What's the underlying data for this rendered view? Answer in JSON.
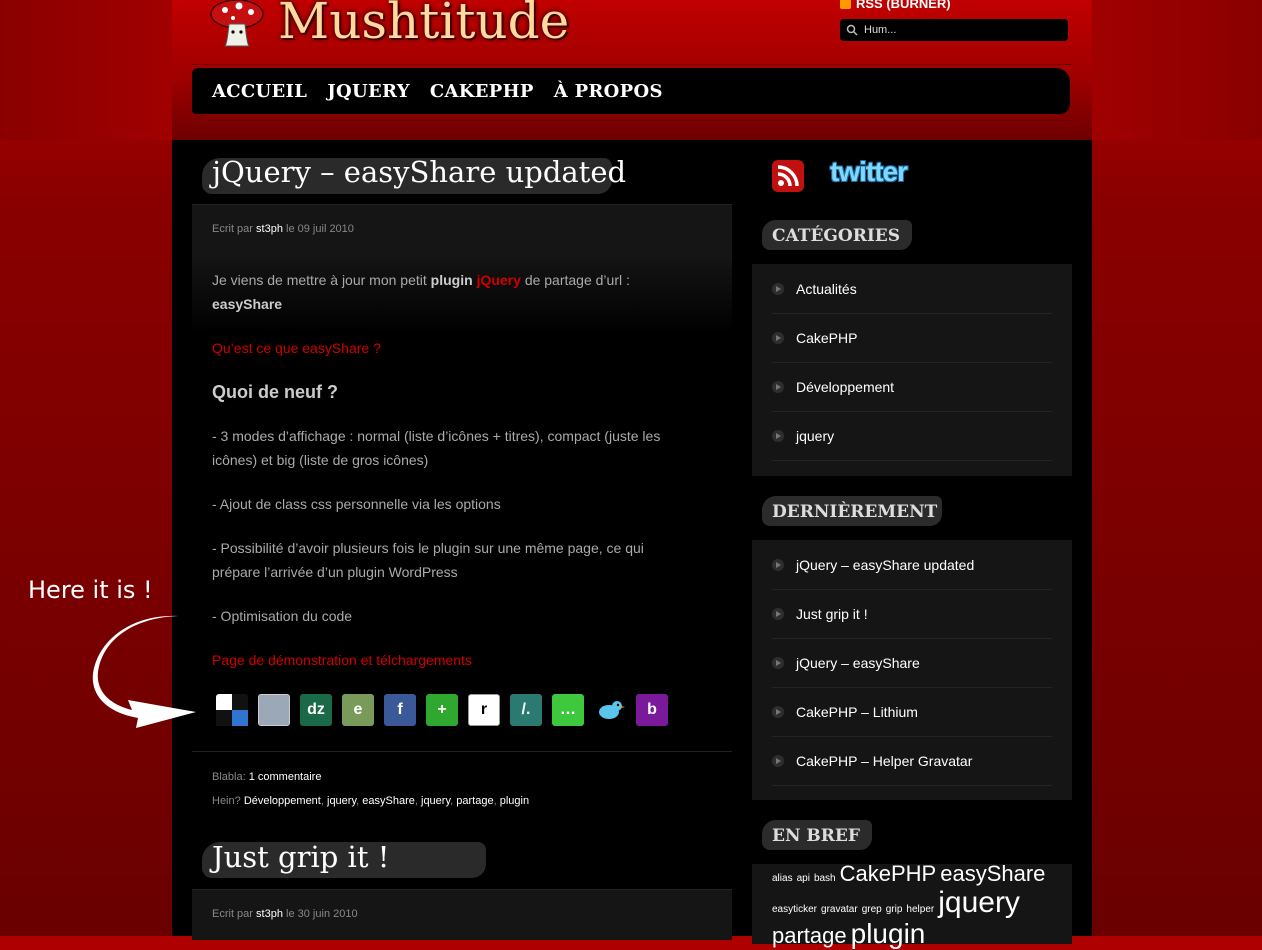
{
  "site": {
    "title": "Mushtitude"
  },
  "header": {
    "rss_label": "RSS (BURNER)",
    "search_value": "Hum..."
  },
  "nav": [
    "ACCUEIL",
    "JQUERY",
    "CAKEPHP",
    "À PROPOS"
  ],
  "posts": [
    {
      "title": "jQuery – easyShare updated",
      "meta_prefix": "Ecrit par",
      "author": "st3ph",
      "meta_date_prefix": "le",
      "date": "09 juil 2010",
      "intro_1": "Je viens de mettre à jour mon petit",
      "intro_plugin": "plugin",
      "intro_jquery": "jQuery",
      "intro_2": "de partage d’url :",
      "intro_easyshare": "easyShare",
      "link_what": "Qu’est ce que easyShare ?",
      "heading_new": "Quoi de neuf ?",
      "p1": "- 3 modes d’affichage : normal (liste d’icônes + titres), compact (juste les icônes) et big (liste de gros icônes)",
      "p2": "- Ajout de class css personnelle via les options",
      "p3": "- Possibilité d’avoir plusieurs fois le plugin sur une même page, ce qui prépare l’arrivée d’un plugin WordPress",
      "p4": "- Optimisation du code",
      "link_demo": "Page de démonstration et télchargements",
      "blabla_label": "Blabla:",
      "comments": "1 commentaire",
      "hein_label": "Hein?",
      "tags": [
        "Développement",
        "jquery",
        "easyShare",
        "jquery",
        "partage",
        "plugin"
      ]
    },
    {
      "title": "Just grip it !",
      "meta_prefix": "Ecrit par",
      "author": "st3ph",
      "meta_date_prefix": "le",
      "date": "30 juin 2010"
    }
  ],
  "share_icons": [
    {
      "name": "delicious-icon",
      "bg": "#ffffff",
      "glyph": ""
    },
    {
      "name": "digg-icon",
      "bg": "#9aa8b8",
      "glyph": ""
    },
    {
      "name": "dzone-icon",
      "bg": "#1a6a4a",
      "glyph": "dz"
    },
    {
      "name": "evernote-icon",
      "bg": "#7a9a5a",
      "glyph": "e"
    },
    {
      "name": "facebook-icon",
      "bg": "#3b5998",
      "glyph": "f"
    },
    {
      "name": "add-icon",
      "bg": "#2ea82e",
      "glyph": "+"
    },
    {
      "name": "reddit-icon",
      "bg": "#ffffff",
      "glyph": "r"
    },
    {
      "name": "slashdot-icon",
      "bg": "#2a7a72",
      "glyph": "/."
    },
    {
      "name": "speech-icon",
      "bg": "#3ec83e",
      "glyph": "…"
    },
    {
      "name": "twitter-bird-icon",
      "bg": "#000000",
      "glyph": ""
    },
    {
      "name": "bebo-icon",
      "bg": "#7a1a9a",
      "glyph": "b"
    }
  ],
  "sidebar": {
    "twitter_label": "twitter",
    "categories_title": "CATÉGORIES",
    "categories": [
      "Actualités",
      "CakePHP",
      "Développement",
      "jquery"
    ],
    "recent_title": "DERNIÈREMENT",
    "recent": [
      "jQuery – easyShare updated",
      "Just grip it !",
      "jQuery – easyShare",
      "CakePHP – Lithium",
      "CakePHP – Helper Gravatar"
    ],
    "tags_title": "EN BREF",
    "tags_line1": [
      {
        "t": "alias",
        "s": 10
      },
      {
        "t": "api",
        "s": 10
      },
      {
        "t": "bash",
        "s": 10
      },
      {
        "t": "CakePHP",
        "s": 22
      },
      {
        "t": "easyShare",
        "s": 22
      }
    ],
    "tags_line2": [
      {
        "t": "easyticker",
        "s": 10
      },
      {
        "t": "gravatar",
        "s": 10
      },
      {
        "t": "grep",
        "s": 10
      },
      {
        "t": "grip",
        "s": 10
      },
      {
        "t": "helper",
        "s": 10
      },
      {
        "t": "jquery",
        "s": 30
      }
    ],
    "tags_line3": [
      {
        "t": "partage",
        "s": 22
      },
      {
        "t": "plugin",
        "s": 28
      }
    ]
  },
  "annotation": {
    "text": "Here it is !"
  }
}
